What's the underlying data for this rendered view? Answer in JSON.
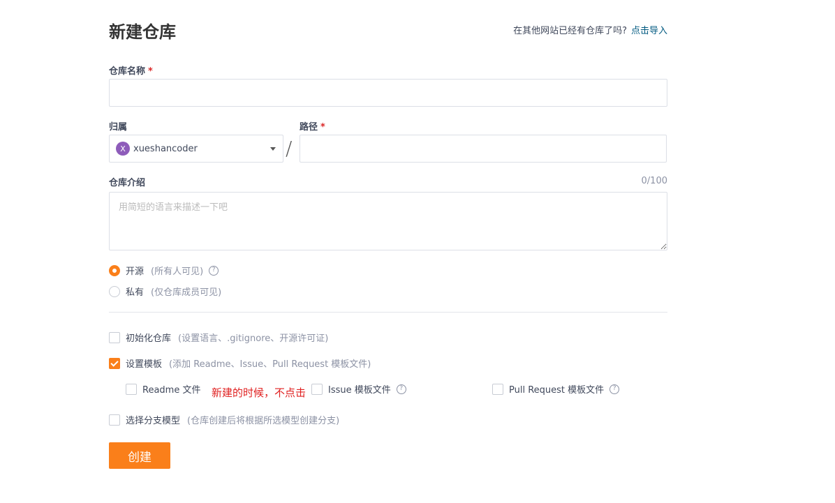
{
  "header": {
    "title": "新建仓库",
    "import_hint": "在其他网站已经有仓库了吗?",
    "import_link": "点击导入"
  },
  "form": {
    "name_label": "仓库名称",
    "required_mark": "*",
    "name_value": "",
    "owner_label": "归属",
    "owner_avatar_letter": "X",
    "owner_value": "xueshancoder",
    "slash": "/",
    "path_label": "路径",
    "path_value": "",
    "desc_label": "仓库介绍",
    "desc_counter": "0/100",
    "desc_placeholder": "用简短的语言来描述一下吧",
    "visibility": {
      "public_label": "开源",
      "public_note": "(所有人可见)",
      "private_label": "私有",
      "private_note": "(仅仓库成员可见)",
      "selected": "public"
    },
    "init_repo": {
      "label": "初始化仓库",
      "note": "(设置语言、.gitignore、开源许可证)",
      "checked": false
    },
    "template": {
      "label": "设置模板",
      "note": "(添加 Readme、Issue、Pull Request 模板文件)",
      "checked": true,
      "options": [
        {
          "label": "Readme 文件",
          "checked": false
        },
        {
          "label": "Issue 模板文件",
          "checked": false
        },
        {
          "label": "Pull Request 模板文件",
          "checked": false
        }
      ]
    },
    "annotation": "新建的时候，不点击",
    "branch_model": {
      "label": "选择分支模型",
      "note": "(仓库创建后将根据所选模型创建分支)",
      "checked": false
    },
    "submit_label": "创建"
  },
  "colors": {
    "accent": "#fa7f1a",
    "link": "#005980",
    "annotation": "#e02020",
    "avatar": "#8e5cba"
  }
}
